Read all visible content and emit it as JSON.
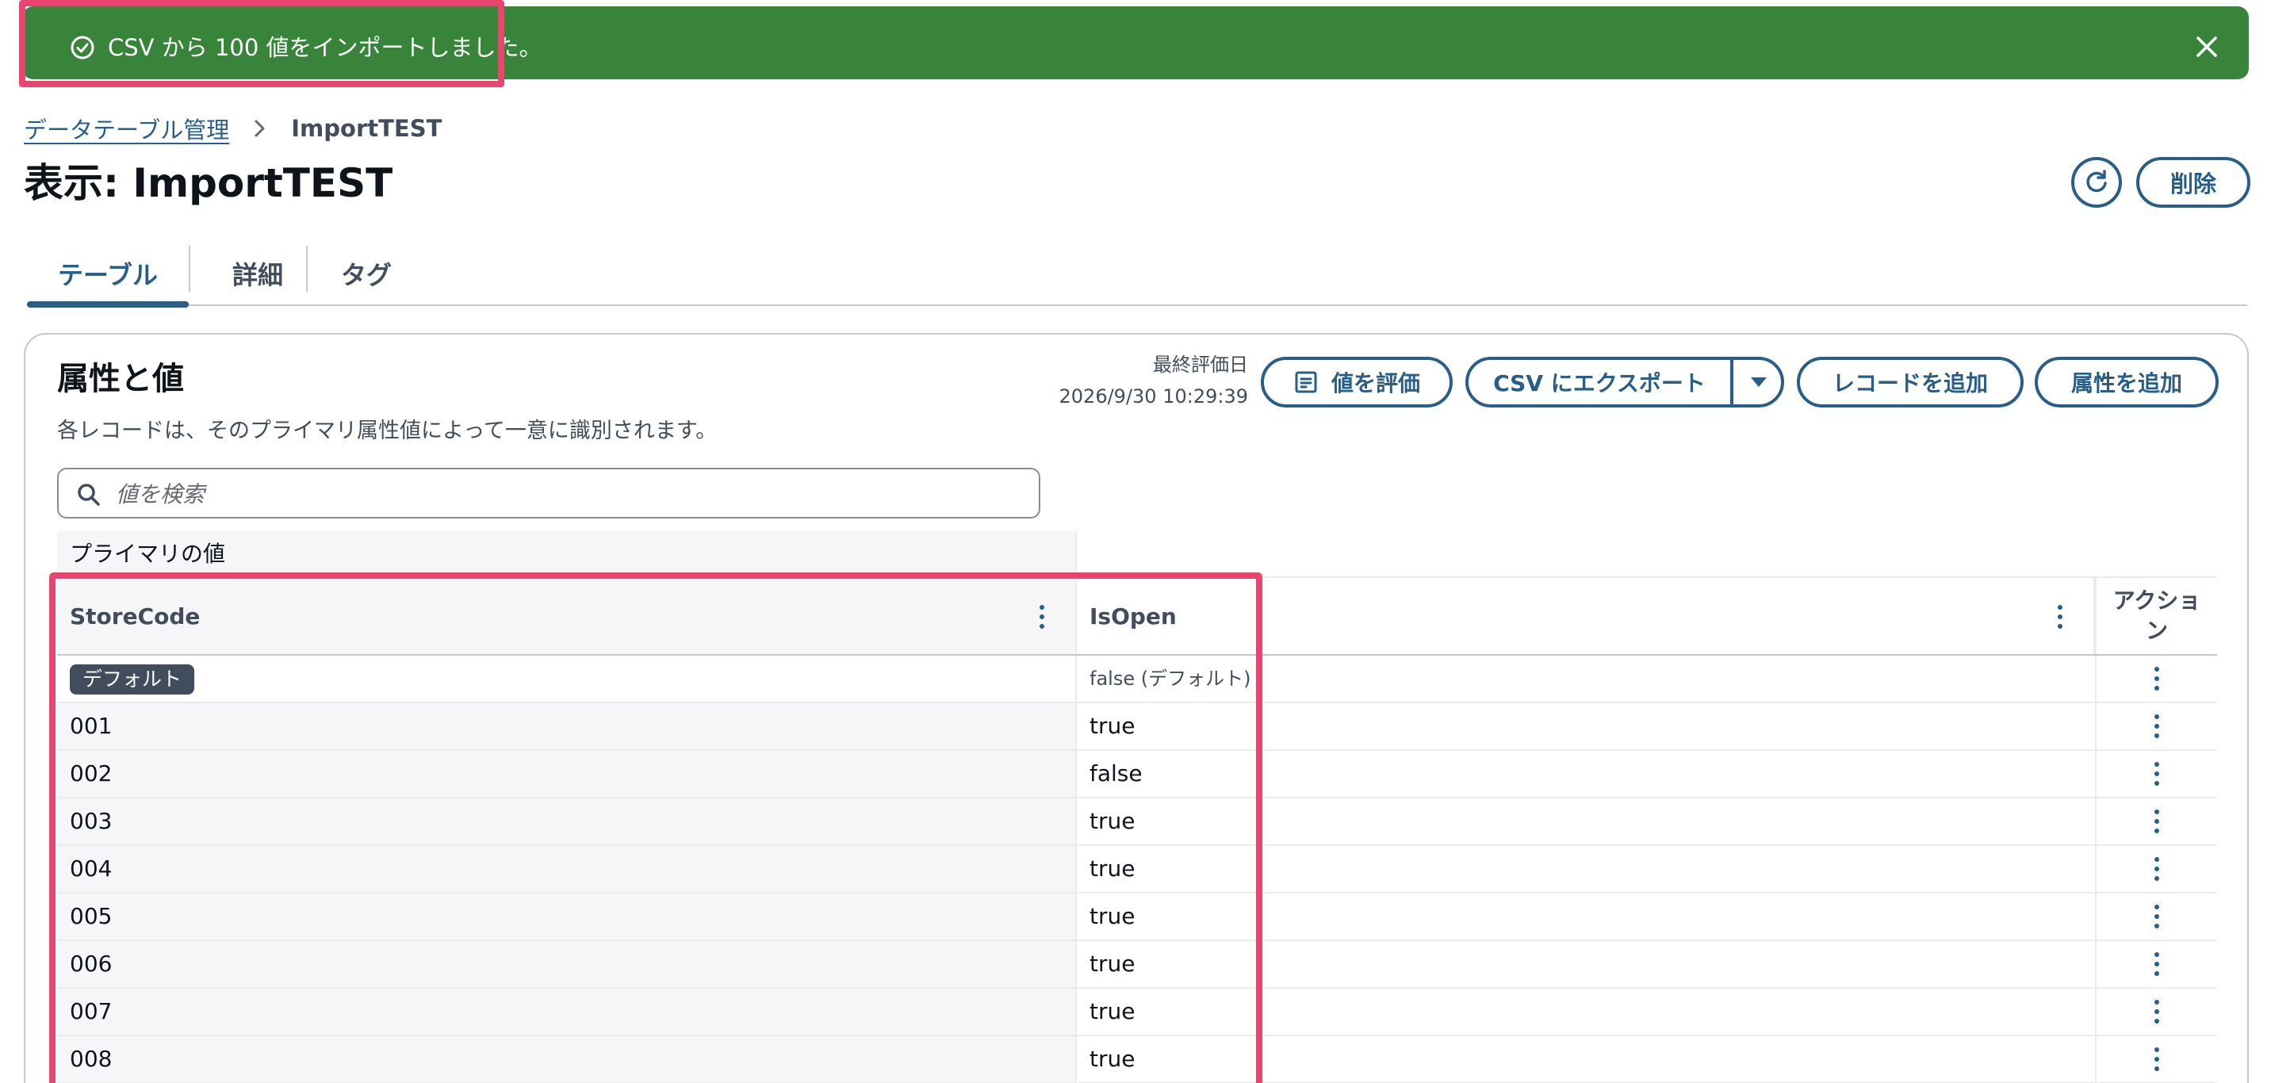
{
  "flash": {
    "message": "CSV から 100 値をインポートしました。",
    "icon": "check-circle-icon",
    "close_icon": "close-icon",
    "color": "#37843a"
  },
  "breadcrumb": {
    "parent": "データテーブル管理",
    "current": "ImportTEST"
  },
  "header": {
    "title": "表示: ImportTEST",
    "refresh_icon": "refresh-icon",
    "delete_label": "削除"
  },
  "tabs": [
    {
      "label": "テーブル",
      "active": true
    },
    {
      "label": "詳細",
      "active": false
    },
    {
      "label": "タグ",
      "active": false
    }
  ],
  "section": {
    "title": "属性と値",
    "description": "各レコードは、そのプライマリ属性値によって一意に識別されます。",
    "last_eval_label": "最終評価日",
    "last_eval_value": "2026/9/30 10:29:39",
    "evaluate_label": "値を評価",
    "export_label": "CSV にエクスポート",
    "add_record_label": "レコードを追加",
    "add_attribute_label": "属性を追加"
  },
  "search": {
    "placeholder": "値を検索",
    "value": ""
  },
  "table": {
    "group_header": "プライマリの値",
    "columns": {
      "store": "StoreCode",
      "isopen": "IsOpen",
      "action": "アクション"
    },
    "default_row": {
      "badge": "デフォルト",
      "isopen": "false (デフォルト)"
    },
    "rows": [
      {
        "store": "001",
        "isopen": "true"
      },
      {
        "store": "002",
        "isopen": "false"
      },
      {
        "store": "003",
        "isopen": "true"
      },
      {
        "store": "004",
        "isopen": "true"
      },
      {
        "store": "005",
        "isopen": "true"
      },
      {
        "store": "006",
        "isopen": "true"
      },
      {
        "store": "007",
        "isopen": "true"
      },
      {
        "store": "008",
        "isopen": "true"
      }
    ]
  },
  "colors": {
    "primary": "#295e87",
    "success": "#37843a",
    "highlight": "#e8466f"
  }
}
